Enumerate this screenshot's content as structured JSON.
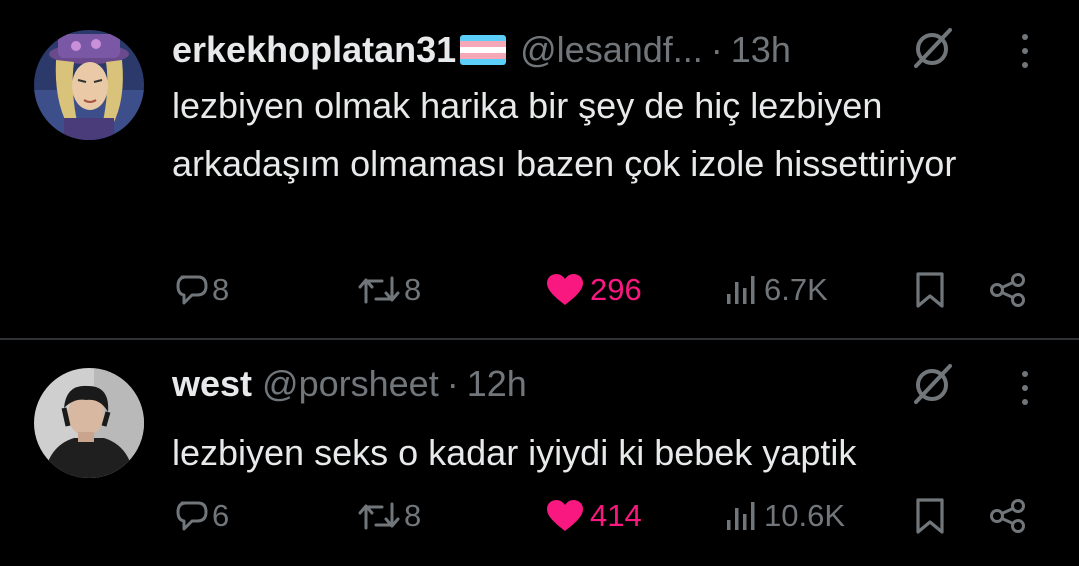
{
  "colors": {
    "background": "#000000",
    "text": "#e7e9ea",
    "muted": "#71767b",
    "like": "#f91880",
    "divider": "#2f3336"
  },
  "posts": [
    {
      "display_name": "erkekhoplatan31",
      "name_emoji": "transgender-flag-icon",
      "handle": "@lesandf...",
      "separator": "·",
      "time": "13h",
      "text": "lezbiyen olmak harika bir şey de hiç lezbiyen arkadaşım olmaması bazen çok izole hissettiriyor",
      "replies": "8",
      "reposts": "8",
      "likes": "296",
      "views": "6.7K"
    },
    {
      "display_name": "west",
      "handle": "@porsheet",
      "separator": "·",
      "time": "12h",
      "text": "lezbiyen seks o kadar iyiydi ki bebek yaptik",
      "replies": "6",
      "reposts": "8",
      "likes": "414",
      "views": "10.6K"
    }
  ]
}
